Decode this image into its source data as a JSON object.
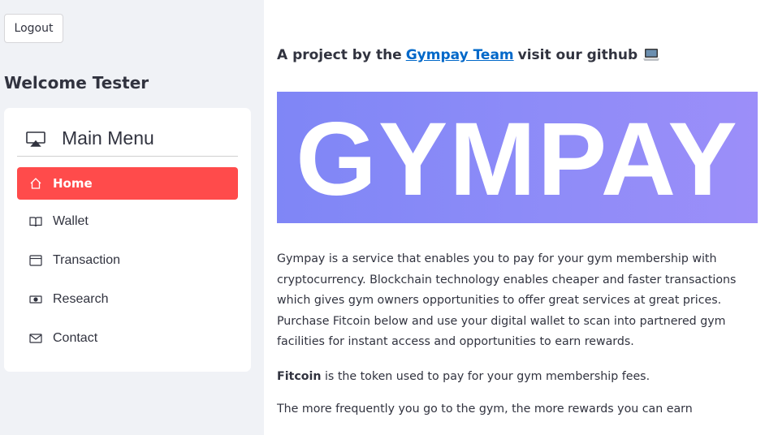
{
  "sidebar": {
    "logout_label": "Logout",
    "welcome_text": "Welcome Tester",
    "menu": {
      "title": "Main Menu",
      "title_icon": "cast-icon",
      "items": [
        {
          "label": "Home",
          "icon": "house-icon",
          "active": true
        },
        {
          "label": "Wallet",
          "icon": "book-icon",
          "active": false
        },
        {
          "label": "Transaction",
          "icon": "window-icon",
          "active": false
        },
        {
          "label": "Research",
          "icon": "cash-icon",
          "active": false
        },
        {
          "label": "Contact",
          "icon": "envelope-icon",
          "active": false
        }
      ]
    },
    "active_color": "#ff4b4b"
  },
  "main": {
    "project_prefix": "A project by the",
    "project_link": "Gympay Team",
    "project_suffix": "visit our github",
    "project_emoji": "laptop-icon",
    "banner_text": "GYMPAY",
    "description": "Gympay is a service that enables you to pay for your gym membership with cryptocurrency. Blockchain technology enables cheaper and faster transactions which gives gym owners opportunities to offer great services at great prices. Purchase Fitcoin below and use your digital wallet to scan into partnered gym facilities for instant access and opportunities to earn rewards.",
    "fitcoin_bold": "Fitcoin",
    "fitcoin_rest": "is the token used to pay for your gym membership fees.",
    "rewards_text": "The more frequently you go to the gym, the more rewards you can earn"
  }
}
